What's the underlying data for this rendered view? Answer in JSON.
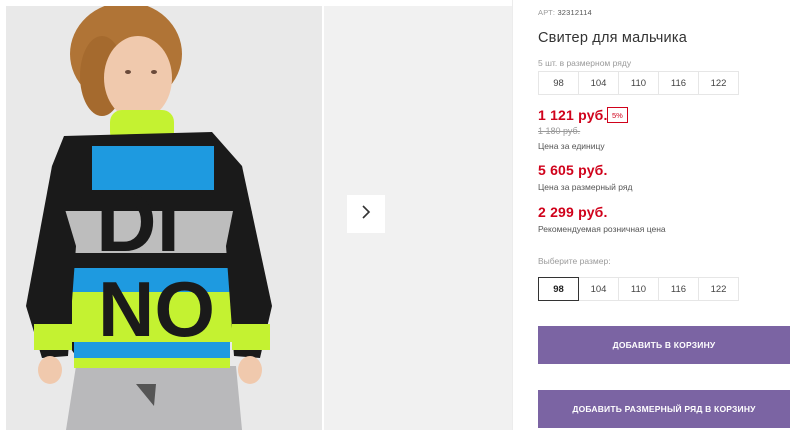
{
  "gallery": {
    "next_icon": "chevron-right-icon"
  },
  "product": {
    "sku_label": "АРТ:",
    "sku": "32312114",
    "title": "Свитер для мальчика",
    "pack_note": "5 шт. в размерном ряду",
    "pack_sizes": [
      "98",
      "104",
      "110",
      "116",
      "122"
    ],
    "unit_price": "1 121 руб.",
    "discount": "5%",
    "old_price": "1 180 руб.",
    "unit_caption": "Цена за единицу",
    "pack_price": "5 605 руб.",
    "pack_caption": "Цена за размерный ряд",
    "rrp_price": "2 299 руб.",
    "rrp_caption": "Рекомендуемая розничная цена"
  },
  "size_selector": {
    "label": "Выберите размер:",
    "options": [
      "98",
      "104",
      "110",
      "116",
      "122"
    ],
    "selected": "98"
  },
  "actions": {
    "add_to_cart": "ДОБАВИТЬ В КОРЗИНУ",
    "add_pack_to_cart": "ДОБАВИТЬ РАЗМЕРНЫЙ РЯД В КОРЗИНУ"
  },
  "colors": {
    "accent": "#7b64a3",
    "price": "#d0021b"
  }
}
